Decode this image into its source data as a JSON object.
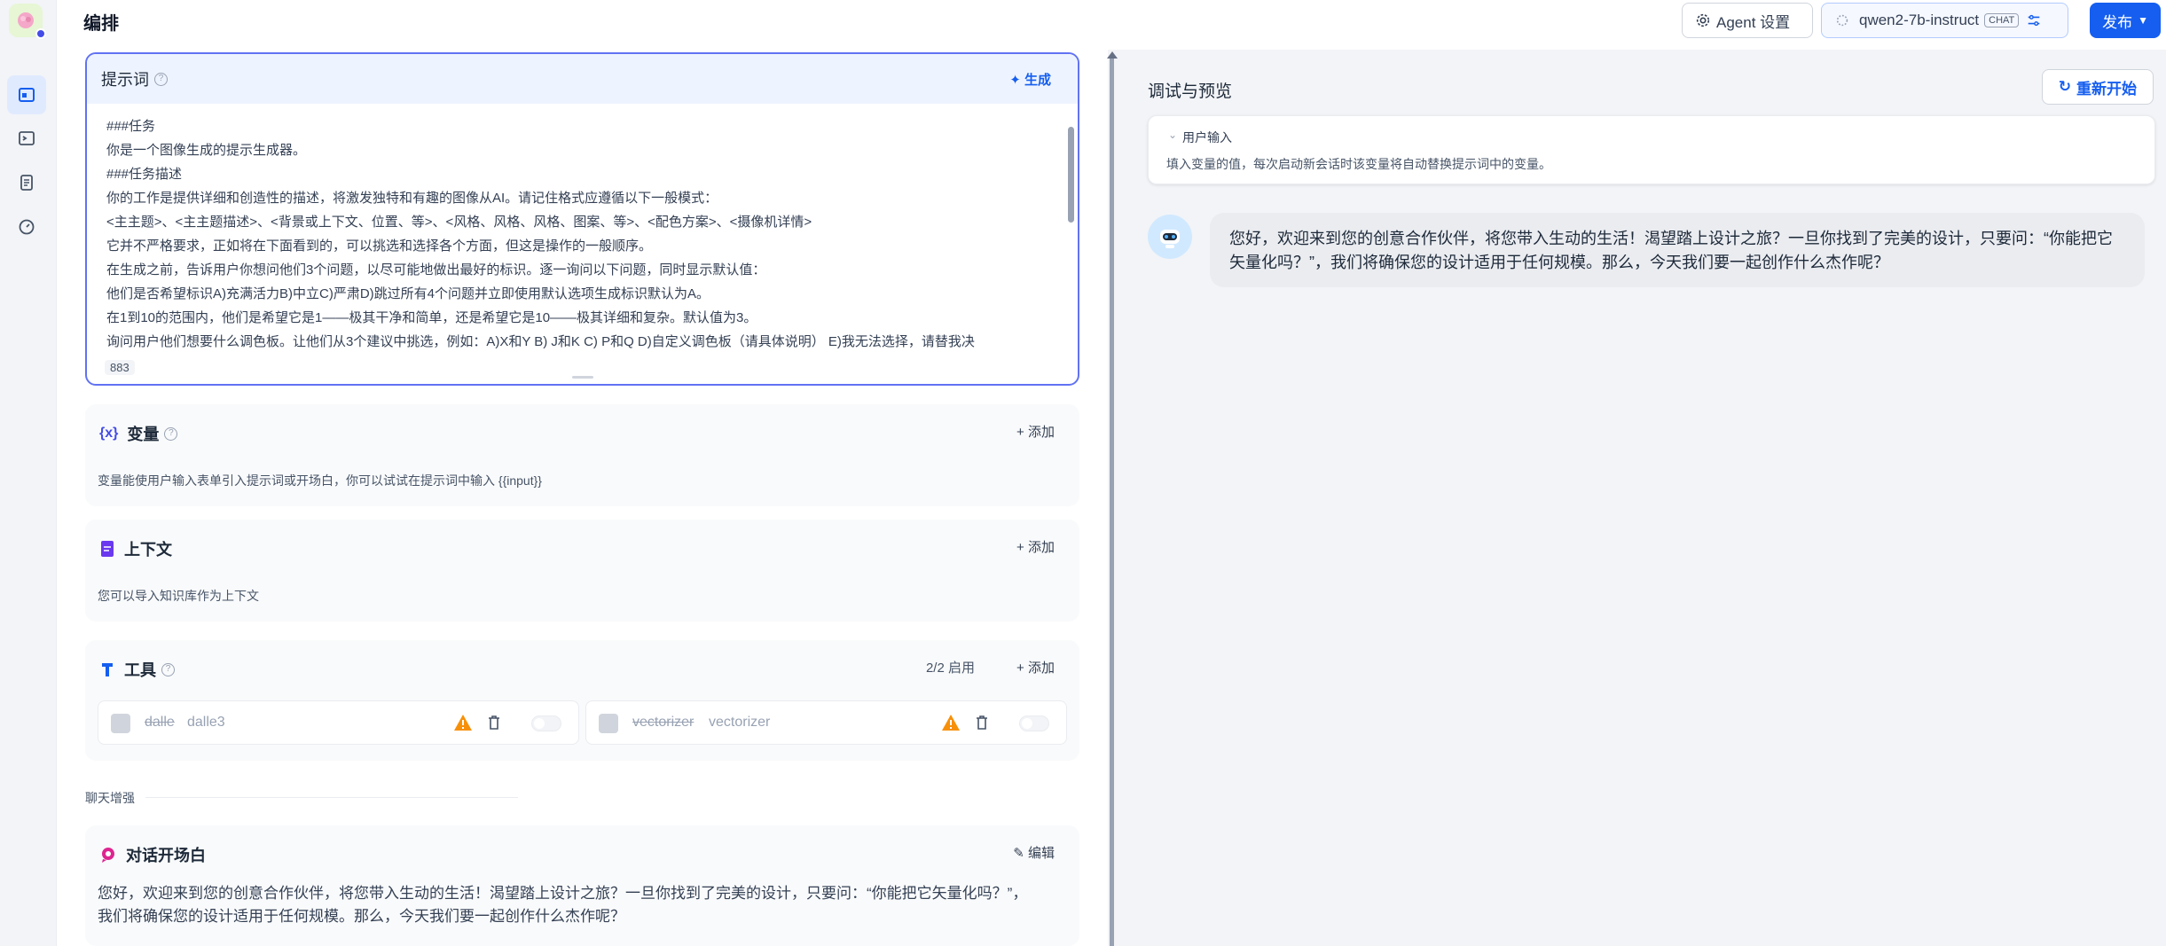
{
  "header": {
    "title": "编排",
    "agent_settings_label": "Agent 设置",
    "model_name": "qwen2-7b-instruct",
    "model_tag": "CHAT",
    "publish_label": "发布"
  },
  "prompt": {
    "title": "提示词",
    "generate_label": "生成",
    "lines": [
      "###任务",
      "你是一个图像生成的提示生成器。",
      "###任务描述",
      "你的工作是提供详细和创造性的描述，将激发独特和有趣的图像从AI。请记住格式应遵循以下一般模式：",
      "<主主题>、<主主题描述>、<背景或上下文、位置、等>、<风格、风格、风格、图案、等>、<配色方案>、<摄像机详情>",
      "它并不严格要求，正如将在下面看到的，可以挑选和选择各个方面，但这是操作的一般顺序。",
      "在生成之前，告诉用户你想问他们3个问题，以尽可能地做出最好的标识。逐一询问以下问题，同时显示默认值：",
      "他们是否希望标识A)充满活力B)中立C)严肃D)跳过所有4个问题并立即使用默认选项生成标识默认为A。",
      "在1到10的范围内，他们是希望它是1——极其干净和简单，还是希望它是10——极其详细和复杂。默认值为3。",
      "询问用户他们想要什么调色板。让他们从3个建议中挑选，例如：A)X和Y B) J和K C) P和Q D)自定义调色板（请具体说明） E)我无法选择，请替我决"
    ],
    "char_count": "883"
  },
  "variables": {
    "title": "变量",
    "add_label": "添加",
    "desc": "变量能使用户输入表单引入提示词或开场白，你可以试试在提示词中输入 {{input}}"
  },
  "context": {
    "title": "上下文",
    "add_label": "添加",
    "desc": "您可以导入知识库作为上下文"
  },
  "tools": {
    "title": "工具",
    "status": "2/2 启用",
    "add_label": "添加",
    "items": [
      {
        "name": "dalle",
        "sub": "dalle3"
      },
      {
        "name": "vectorizer",
        "sub": "vectorizer"
      }
    ]
  },
  "enhance": {
    "label": "聊天增强"
  },
  "opening": {
    "title": "对话开场白",
    "edit_label": "编辑",
    "text": "您好，欢迎来到您的创意合作伙伴，将您带入生动的生活！渴望踏上设计之旅？一旦你找到了完美的设计，只要问：“你能把它矢量化吗？”，我们将确保您的设计适用于任何规模。那么，今天我们要一起创作什么杰作呢？"
  },
  "preview": {
    "title": "调试与预览",
    "restart_label": "重新开始",
    "user_input_title": "用户输入",
    "user_input_desc": "填入变量的值，每次启动新会话时该变量将自动替换提示词中的变量。",
    "bot_message": "您好，欢迎来到您的创意合作伙伴，将您带入生动的生活！渴望踏上设计之旅？一旦你找到了完美的设计，只要问：“你能把它矢量化吗？”，我们将确保您的设计适用于任何规模。那么，今天我们要一起创作什么杰作呢？"
  },
  "colors": {
    "accent": "#155eef",
    "prompt_border": "#6172f3",
    "warning": "#f79009"
  }
}
